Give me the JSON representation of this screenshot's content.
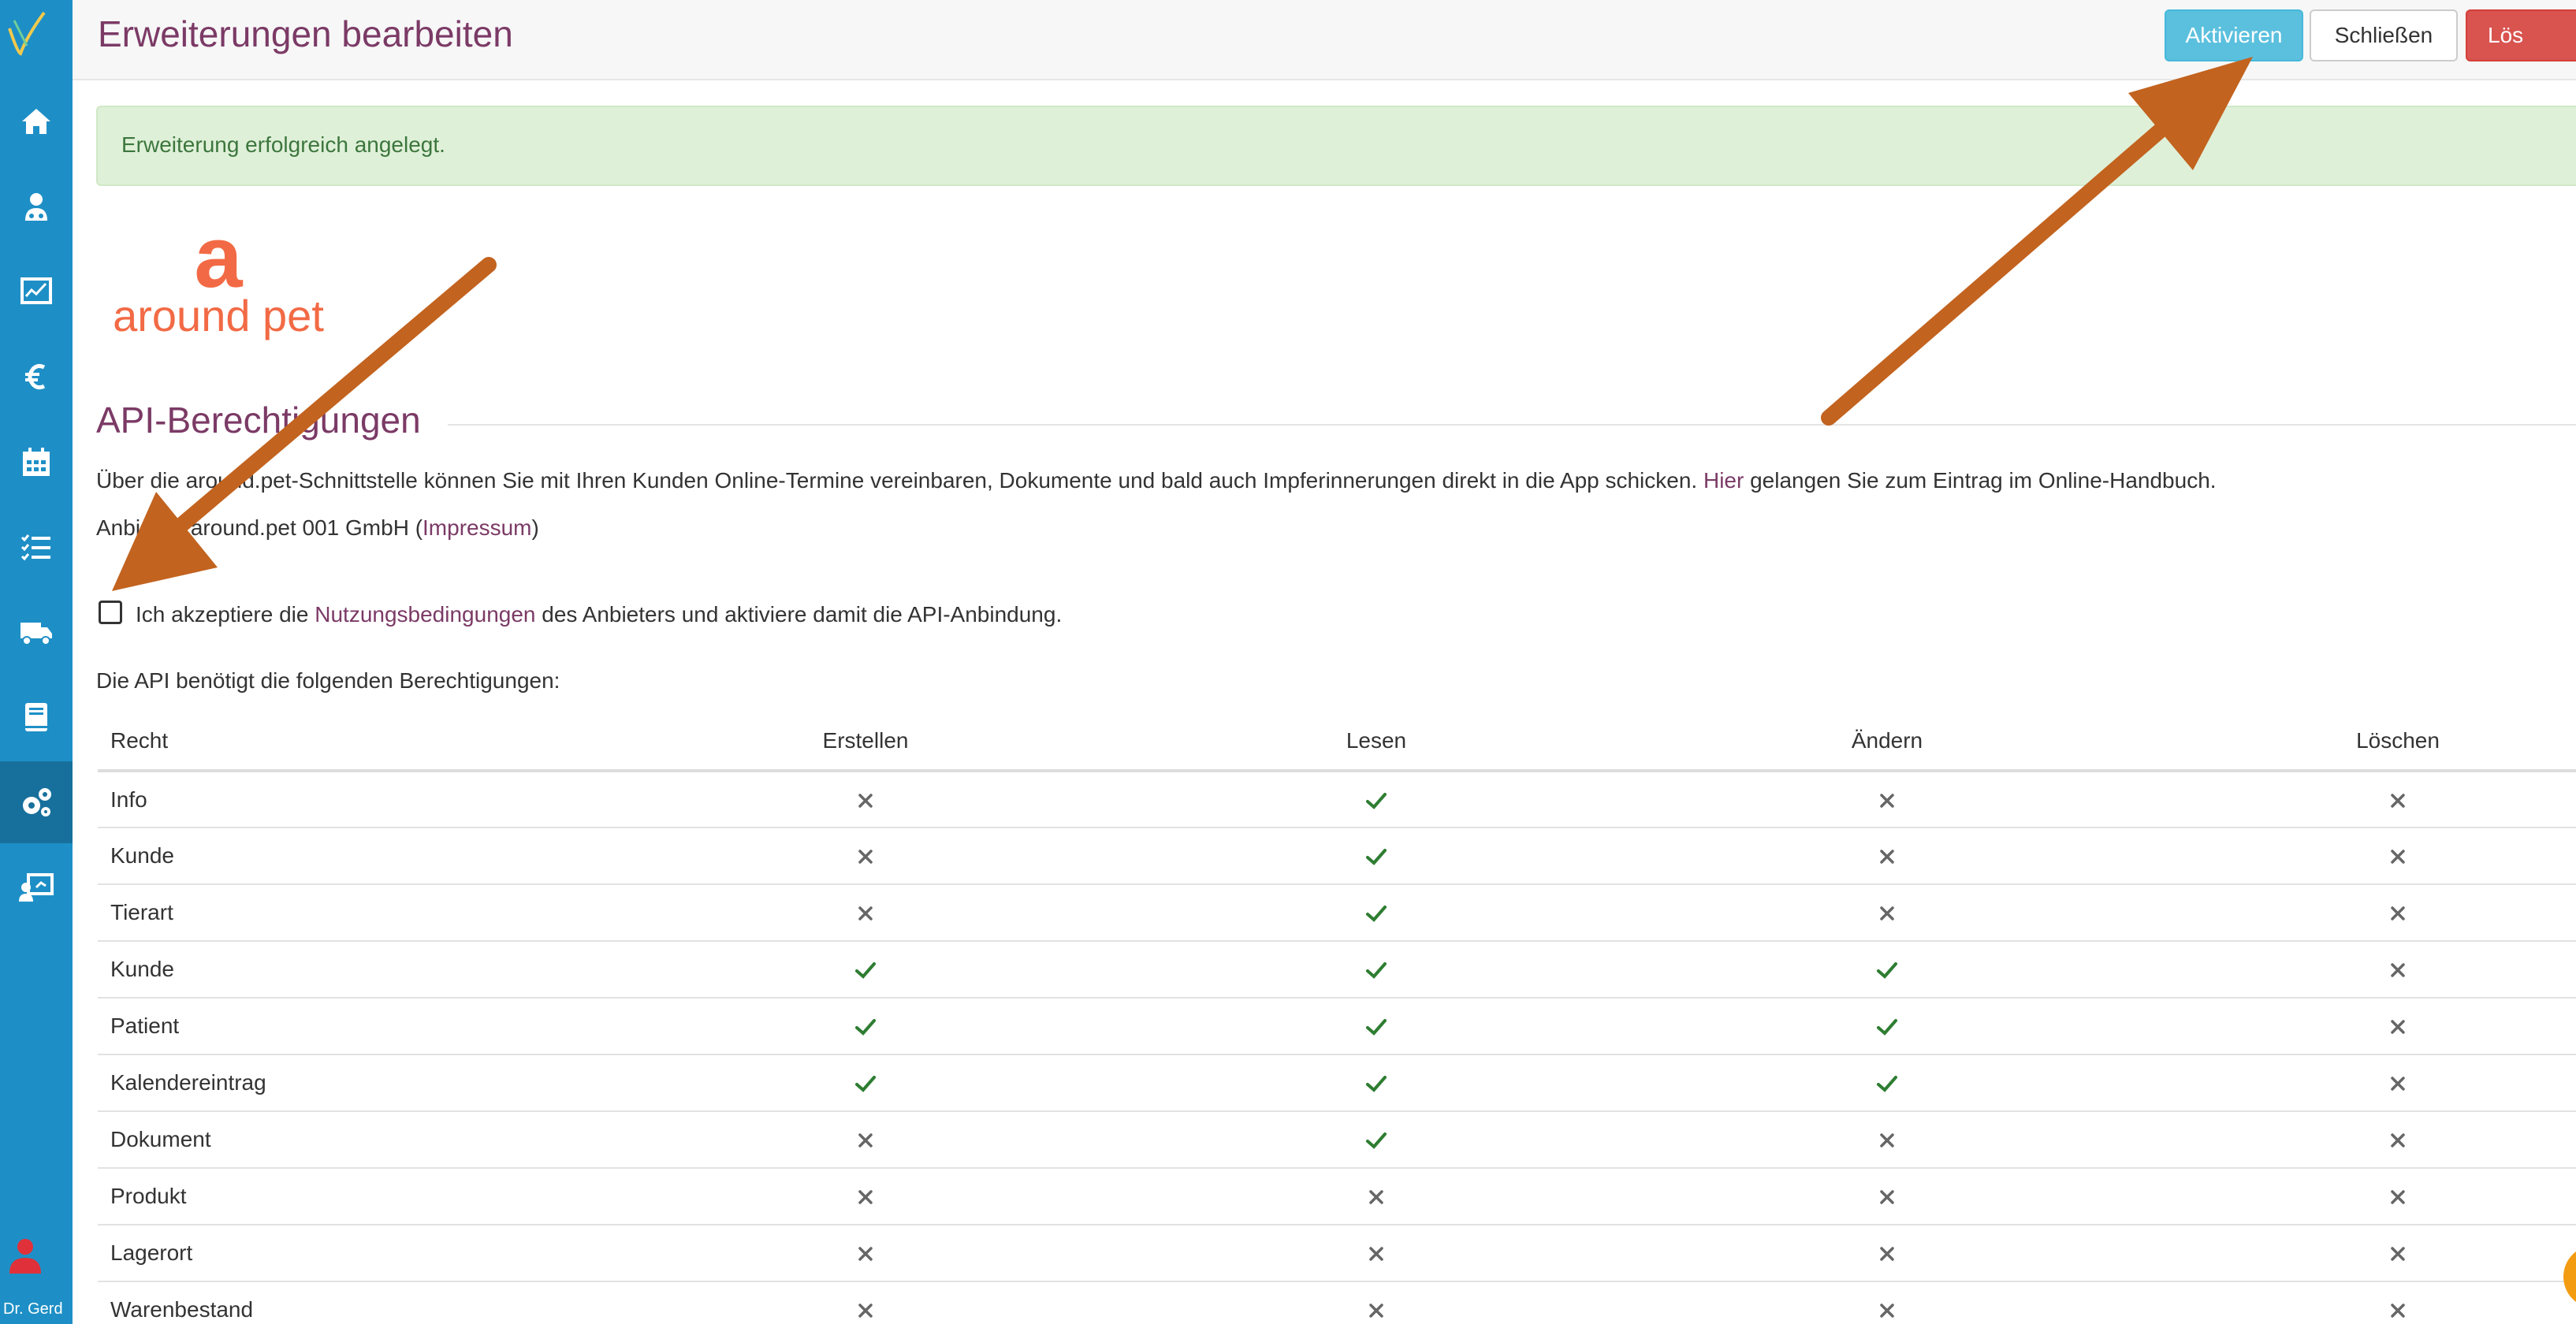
{
  "header": {
    "title": "Erweiterungen bearbeiten",
    "buttons": {
      "activate": "Aktivieren",
      "close": "Schließen",
      "delete": "Lös"
    }
  },
  "sidebar": {
    "items": [
      {
        "icon": "home-icon"
      },
      {
        "icon": "veterinarian-icon"
      },
      {
        "icon": "monitor-chart-icon"
      },
      {
        "icon": "euro-icon"
      },
      {
        "icon": "calendar-icon"
      },
      {
        "icon": "checklist-icon"
      },
      {
        "icon": "truck-icon"
      },
      {
        "icon": "book-icon"
      },
      {
        "icon": "gears-icon",
        "active": true
      },
      {
        "icon": "presentation-user-icon"
      }
    ],
    "user": {
      "name": "Dr. Gerd"
    }
  },
  "alert": {
    "text": "Erweiterung erfolgreich angelegt."
  },
  "brand": {
    "letter": "a",
    "name": "around pet"
  },
  "section": {
    "heading": "API-Berechtigungen",
    "description_part1": "Über die around.pet-Schnittstelle können Sie mit Ihren Kunden Online-Termine vereinbaren, Dokumente und bald auch Impferinnerungen direkt in die App schicken.",
    "description_link": "Hier",
    "description_part2": "gelangen Sie zum Eintrag im Online-Handbuch.",
    "provider_prefix": "Anbieter: around.pet 001 GmbH (",
    "provider_link": "Impressum",
    "provider_suffix": ")",
    "checkbox_part1": "Ich akzeptiere die",
    "checkbox_link": "Nutzungsbedingungen",
    "checkbox_part2": "des Anbieters und aktiviere damit die API-Anbindung.",
    "checkbox_checked": false,
    "permissions_intro": "Die API benötigt die folgenden Berechtigungen:"
  },
  "table": {
    "headers": [
      "Recht",
      "Erstellen",
      "Lesen",
      "Ändern",
      "Löschen"
    ],
    "rows": [
      {
        "name": "Info",
        "create": false,
        "read": true,
        "update": false,
        "delete": false
      },
      {
        "name": "Kunde",
        "create": false,
        "read": true,
        "update": false,
        "delete": false
      },
      {
        "name": "Tierart",
        "create": false,
        "read": true,
        "update": false,
        "delete": false
      },
      {
        "name": "Kunde",
        "create": true,
        "read": true,
        "update": true,
        "delete": false
      },
      {
        "name": "Patient",
        "create": true,
        "read": true,
        "update": true,
        "delete": false
      },
      {
        "name": "Kalendereintrag",
        "create": true,
        "read": true,
        "update": true,
        "delete": false
      },
      {
        "name": "Dokument",
        "create": false,
        "read": true,
        "update": false,
        "delete": false
      },
      {
        "name": "Produkt",
        "create": false,
        "read": false,
        "update": false,
        "delete": false
      },
      {
        "name": "Lagerort",
        "create": false,
        "read": false,
        "update": false,
        "delete": false
      },
      {
        "name": "Warenbestand",
        "create": false,
        "read": false,
        "update": false,
        "delete": false
      }
    ]
  },
  "colors": {
    "sidebar": "#1e8fc6",
    "title": "#7b3a66",
    "check": "#2e7d32",
    "cross": "#666666",
    "arrow": "#c2631f",
    "brand": "#f26a45"
  }
}
